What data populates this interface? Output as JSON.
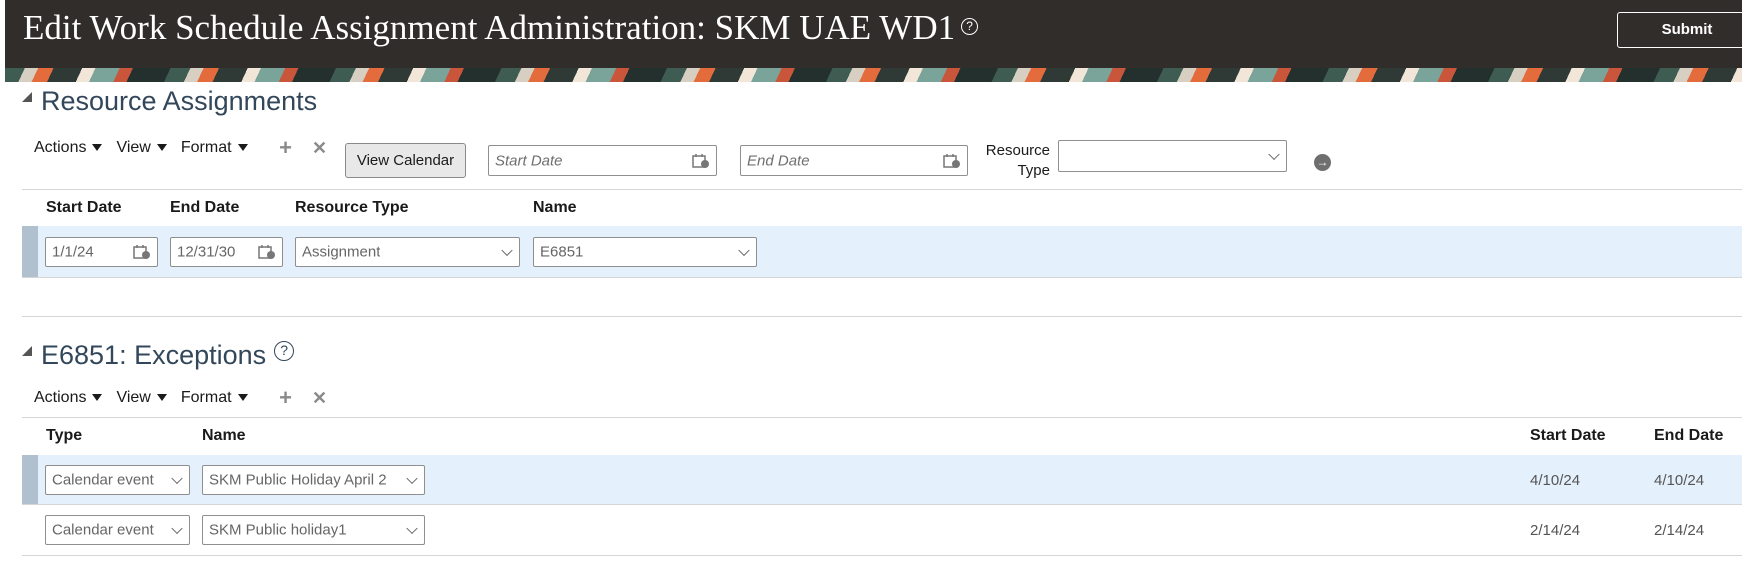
{
  "header": {
    "title": "Edit Work Schedule Assignment Administration: SKM UAE WD1",
    "help_symbol": "?",
    "submit_label": "Submit"
  },
  "resource_assignments": {
    "title": "Resource Assignments",
    "toolbar": {
      "actions_label": "Actions",
      "view_label": "View",
      "format_label": "Format",
      "add_symbol": "+",
      "delete_symbol": "✕",
      "view_calendar_label": "View Calendar"
    },
    "filters": {
      "start_date_placeholder": "Start Date",
      "end_date_placeholder": "End Date",
      "resource_type_label_1": "Resource",
      "resource_type_label_2": "Type",
      "resource_type_value": "",
      "go_symbol": "→"
    },
    "columns": [
      "Start Date",
      "End Date",
      "Resource Type",
      "Name"
    ],
    "rows": [
      {
        "start_date": "1/1/24",
        "end_date": "12/31/30",
        "resource_type": "Assignment",
        "name": "E6851"
      }
    ]
  },
  "exceptions": {
    "title": "E6851: Exceptions",
    "toolbar": {
      "actions_label": "Actions",
      "view_label": "View",
      "format_label": "Format",
      "add_symbol": "+",
      "delete_symbol": "✕"
    },
    "columns": [
      "Type",
      "Name",
      "Start Date",
      "End Date"
    ],
    "rows": [
      {
        "type": "Calendar event",
        "name": "SKM Public Holiday April 2",
        "start_date": "4/10/24",
        "end_date": "4/10/24"
      },
      {
        "type": "Calendar event",
        "name": "SKM Public holiday1",
        "start_date": "2/14/24",
        "end_date": "2/14/24"
      }
    ]
  },
  "colors": {
    "header_bg": "#312d2a",
    "selected_row_bg": "#e4f0fb",
    "section_title": "#33475b"
  }
}
